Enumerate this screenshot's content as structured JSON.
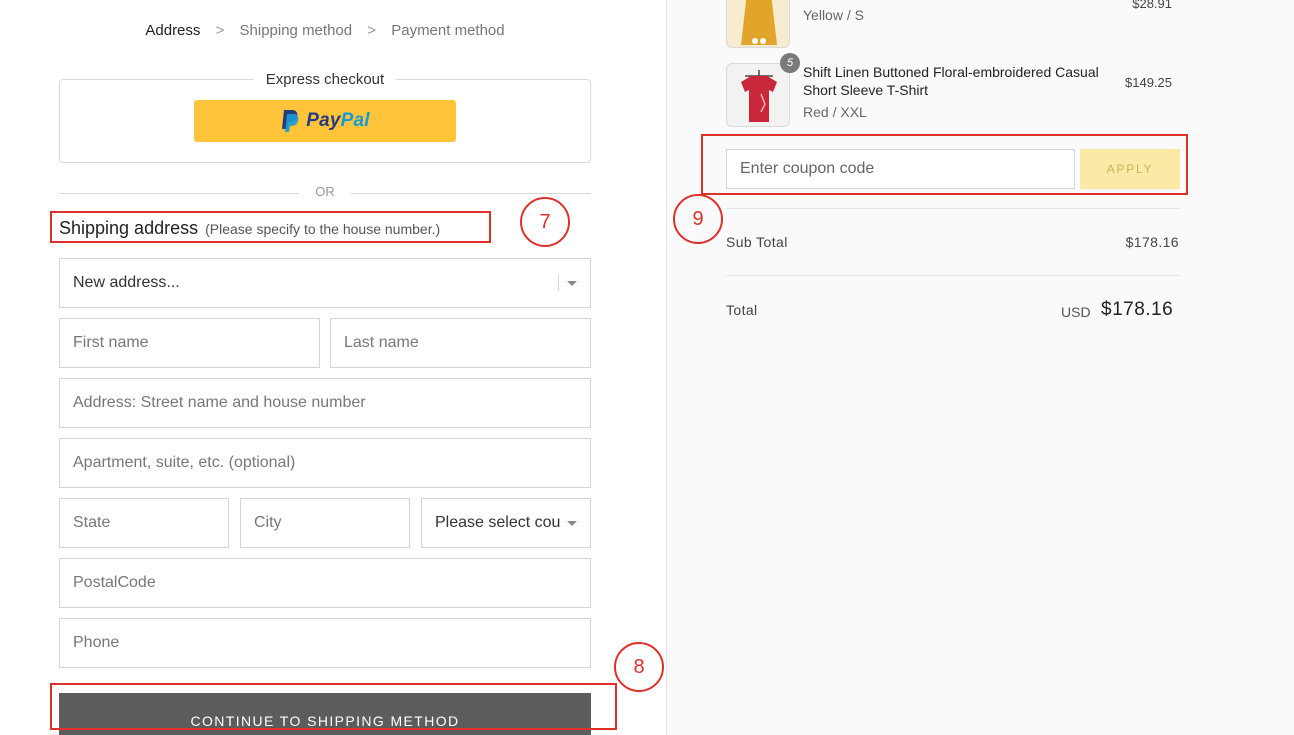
{
  "breadcrumb": {
    "steps": [
      "Address",
      "Shipping method",
      "Payment method"
    ],
    "separator": ">"
  },
  "express_checkout": {
    "title": "Express checkout",
    "paypal": {
      "pay": "Pay",
      "pal": "Pal",
      "color": "#ffc439"
    }
  },
  "or_text": "OR",
  "shipping": {
    "heading": "Shipping address",
    "note": "(Please specify to the house number.)"
  },
  "form": {
    "address_select": "New address...",
    "first_name_placeholder": "First name",
    "last_name_placeholder": "Last name",
    "address_placeholder": "Address: Street name and house number",
    "apartment_placeholder": "Apartment, suite, etc. (optional)",
    "state_placeholder": "State",
    "city_placeholder": "City",
    "country_select": "Please select country",
    "postal_placeholder": "PostalCode",
    "phone_placeholder": "Phone",
    "continue_label": "CONTINUE TO SHIPPING METHOD"
  },
  "annotations": [
    "7",
    "8",
    "9"
  ],
  "cart": {
    "items": [
      {
        "name": "",
        "variant": "Yellow / S",
        "price": "$28.91",
        "thumb_color": "#e0a52a"
      },
      {
        "name": "Shift Linen Buttoned Floral-embroidered Casual Short Sleeve T-Shirt",
        "variant": "Red / XXL",
        "price": "$149.25",
        "quantity": "5",
        "thumb_color": "#c9283a"
      }
    ],
    "coupon_placeholder": "Enter coupon code",
    "apply_label": "APPLY",
    "subtotal_label": "Sub Total",
    "subtotal_value": "$178.16",
    "total_label": "Total",
    "total_currency": "USD",
    "total_value": "$178.16"
  },
  "colors": {
    "annotation_red": "#e0302a",
    "continue_button": "#5c5c5c",
    "apply_button": "#faeaa6"
  }
}
